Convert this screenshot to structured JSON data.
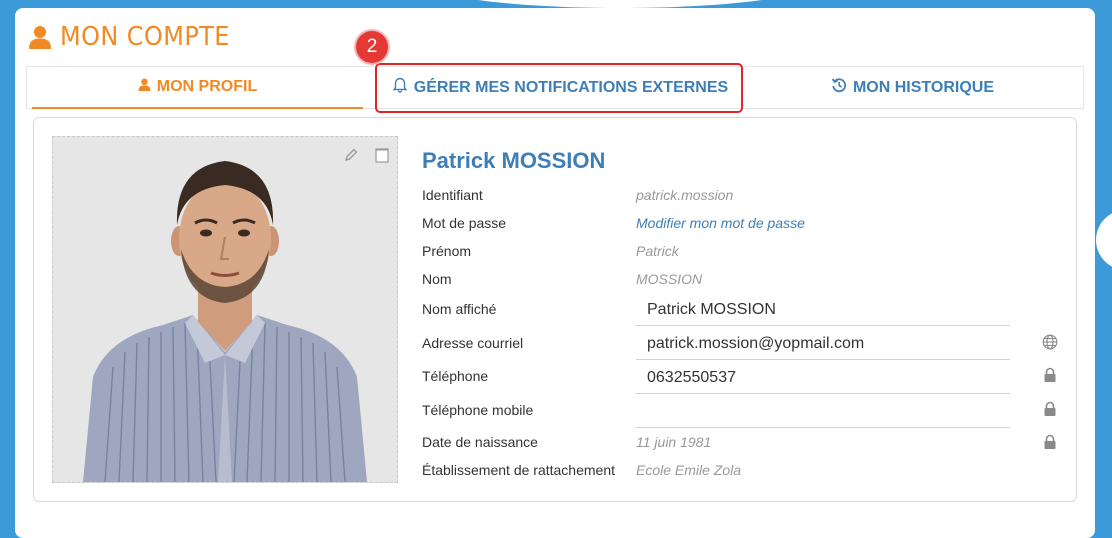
{
  "page": {
    "title": "MON COMPTE",
    "accent_color": "#f08a24",
    "link_color": "#3d7fb6"
  },
  "tabs": [
    {
      "label": "MON PROFIL",
      "icon": "user-icon",
      "active": true
    },
    {
      "label": "GÉRER MES NOTIFICATIONS EXTERNES",
      "icon": "bell-icon",
      "active": false
    },
    {
      "label": "MON HISTORIQUE",
      "icon": "history-icon",
      "active": false
    }
  ],
  "step_badge": "2",
  "profile": {
    "full_name": "Patrick MOSSION",
    "rows": [
      {
        "label": "Identifiant",
        "value": "patrick.mossion"
      },
      {
        "label": "Mot de passe",
        "value": "Modifier mon mot de passe"
      },
      {
        "label": "Prénom",
        "value": "Patrick"
      },
      {
        "label": "Nom",
        "value": "MOSSION"
      },
      {
        "label": "Nom affiché",
        "value": "Patrick MOSSION"
      },
      {
        "label": "Adresse courriel",
        "value": "patrick.mossion@yopmail.com",
        "icon": "globe-icon"
      },
      {
        "label": "Téléphone",
        "value": "0632550537",
        "icon": "lock-icon"
      },
      {
        "label": "Téléphone mobile",
        "value": "",
        "icon": "lock-icon"
      },
      {
        "label": "Date de naissance",
        "value": "11 juin 1981",
        "icon": "lock-icon"
      },
      {
        "label": "Établissement de rattachement",
        "value": "Ecole Emile Zola"
      }
    ]
  }
}
